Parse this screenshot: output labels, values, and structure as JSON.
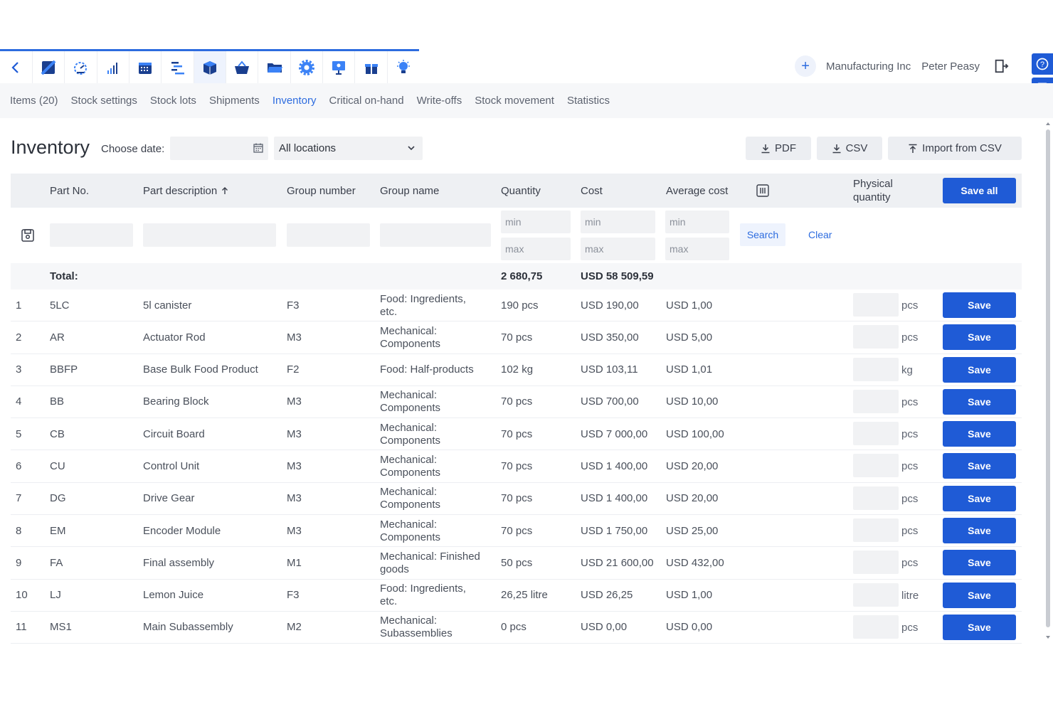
{
  "modules": [
    {
      "icon": "back-chevron-icon"
    },
    {
      "icon": "sales-icon"
    },
    {
      "icon": "dashboard-icon"
    },
    {
      "icon": "statistics-icon"
    },
    {
      "icon": "calendar-icon"
    },
    {
      "icon": "planning-icon"
    },
    {
      "icon": "stock-box-icon"
    },
    {
      "icon": "purchasing-basket-icon"
    },
    {
      "icon": "folder-icon"
    },
    {
      "icon": "settings-gear-icon"
    },
    {
      "icon": "presentation-icon"
    },
    {
      "icon": "gift-icon"
    },
    {
      "icon": "lightbulb-icon"
    }
  ],
  "header": {
    "company": "Manufacturing Inc",
    "user": "Peter Peasy"
  },
  "subnav": [
    {
      "label": "Items (20)",
      "active": false
    },
    {
      "label": "Stock settings",
      "active": false
    },
    {
      "label": "Stock lots",
      "active": false
    },
    {
      "label": "Shipments",
      "active": false
    },
    {
      "label": "Inventory",
      "active": true
    },
    {
      "label": "Critical on-hand",
      "active": false
    },
    {
      "label": "Write-offs",
      "active": false
    },
    {
      "label": "Stock movement",
      "active": false
    },
    {
      "label": "Statistics",
      "active": false
    }
  ],
  "page": {
    "title": "Inventory",
    "date_label": "Choose date:",
    "location": "All locations",
    "pdf_label": "PDF",
    "csv_label": "CSV",
    "import_label": "Import from CSV"
  },
  "columns": {
    "part_no": "Part No.",
    "part_desc": "Part description",
    "group_number": "Group number",
    "group_name": "Group name",
    "quantity": "Quantity",
    "cost": "Cost",
    "avg_cost": "Average cost",
    "physical_line1": "Physical",
    "physical_line2": "quantity",
    "save_all": "Save all"
  },
  "filters": {
    "min": "min",
    "max": "max",
    "search": "Search",
    "clear": "Clear"
  },
  "totals": {
    "label": "Total:",
    "quantity": "2 680,75",
    "cost": "USD 58 509,59"
  },
  "save_label": "Save",
  "rows": [
    {
      "n": "1",
      "part": "5LC",
      "desc": "5l canister",
      "gnum": "F3",
      "gname": "Food: Ingredients, etc.",
      "qty": "190 pcs",
      "cost": "USD 190,00",
      "avg": "USD 1,00",
      "unit": "pcs"
    },
    {
      "n": "2",
      "part": "AR",
      "desc": "Actuator Rod",
      "gnum": "M3",
      "gname": "Mechanical: Components",
      "qty": "70 pcs",
      "cost": "USD 350,00",
      "avg": "USD 5,00",
      "unit": "pcs"
    },
    {
      "n": "3",
      "part": "BBFP",
      "desc": "Base Bulk Food Product",
      "gnum": "F2",
      "gname": "Food: Half-products",
      "qty": "102 kg",
      "cost": "USD 103,11",
      "avg": "USD 1,01",
      "unit": "kg"
    },
    {
      "n": "4",
      "part": "BB",
      "desc": "Bearing Block",
      "gnum": "M3",
      "gname": "Mechanical: Components",
      "qty": "70 pcs",
      "cost": "USD 700,00",
      "avg": "USD 10,00",
      "unit": "pcs"
    },
    {
      "n": "5",
      "part": "CB",
      "desc": "Circuit Board",
      "gnum": "M3",
      "gname": "Mechanical: Components",
      "qty": "70 pcs",
      "cost": "USD 7 000,00",
      "avg": "USD 100,00",
      "unit": "pcs"
    },
    {
      "n": "6",
      "part": "CU",
      "desc": "Control Unit",
      "gnum": "M3",
      "gname": "Mechanical: Components",
      "qty": "70 pcs",
      "cost": "USD 1 400,00",
      "avg": "USD 20,00",
      "unit": "pcs"
    },
    {
      "n": "7",
      "part": "DG",
      "desc": "Drive Gear",
      "gnum": "M3",
      "gname": "Mechanical: Components",
      "qty": "70 pcs",
      "cost": "USD 1 400,00",
      "avg": "USD 20,00",
      "unit": "pcs"
    },
    {
      "n": "8",
      "part": "EM",
      "desc": "Encoder Module",
      "gnum": "M3",
      "gname": "Mechanical: Components",
      "qty": "70 pcs",
      "cost": "USD 1 750,00",
      "avg": "USD 25,00",
      "unit": "pcs"
    },
    {
      "n": "9",
      "part": "FA",
      "desc": "Final assembly",
      "gnum": "M1",
      "gname": "Mechanical: Finished goods",
      "qty": "50 pcs",
      "cost": "USD 21 600,00",
      "avg": "USD 432,00",
      "unit": "pcs"
    },
    {
      "n": "10",
      "part": "LJ",
      "desc": "Lemon Juice",
      "gnum": "F3",
      "gname": "Food: Ingredients, etc.",
      "qty": "26,25 litre",
      "cost": "USD 26,25",
      "avg": "USD 1,00",
      "unit": "litre"
    },
    {
      "n": "11",
      "part": "MS1",
      "desc": "Main Subassembly",
      "gnum": "M2",
      "gname": "Mechanical: Subassemblies",
      "qty": "0 pcs",
      "cost": "USD 0,00",
      "avg": "USD 0,00",
      "unit": "pcs"
    }
  ]
}
